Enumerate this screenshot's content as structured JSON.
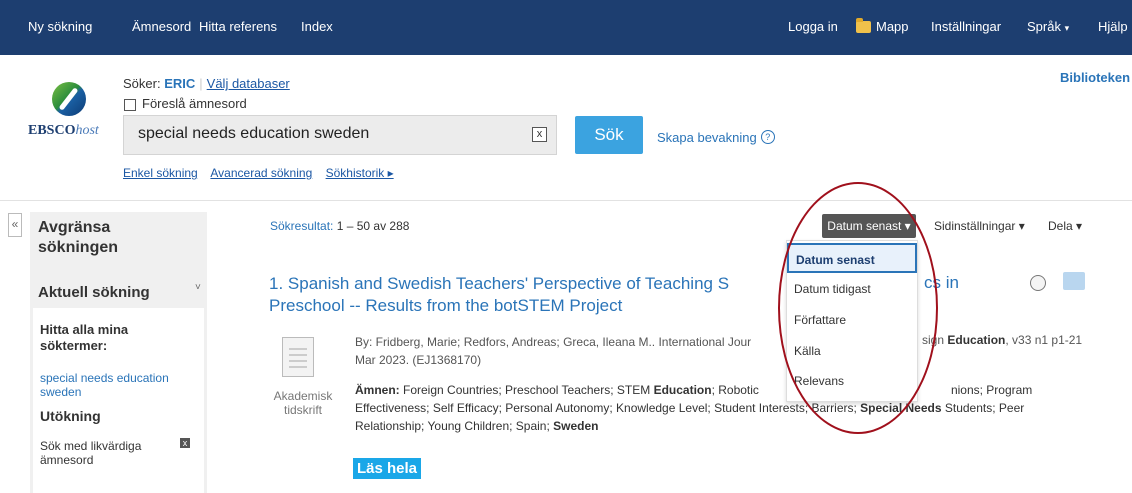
{
  "topnav": {
    "new_search": "Ny sökning",
    "subjects": "Ämnesord",
    "find_reference": "Hitta referens",
    "index": "Index",
    "login": "Logga in",
    "folder": "Mapp",
    "settings": "Inställningar",
    "language": "Språk",
    "language_caret": "▾",
    "help": "Hjälp"
  },
  "header": {
    "logo_text_main": "EBSCO",
    "logo_text_host": "host",
    "searching_label": "Söker:",
    "database": "ERIC",
    "choose_databases": "Välj databaser",
    "suggest_subjects": "Föreslå ämnesord",
    "search_value": "special needs education sweden",
    "clear_label": "x",
    "search_button": "Sök",
    "create_alert": "Skapa bevakning",
    "help_glyph": "?",
    "basic_search": "Enkel sökning",
    "advanced_search": "Avancerad sökning",
    "search_history": "Sökhistorik ▸",
    "library": "Biblioteken"
  },
  "sidebar": {
    "collapse_glyph": "«",
    "title": "Avgränsa sökningen",
    "current_search": "Aktuell sökning",
    "current_chevron": "˅",
    "find_all_terms": "Hitta alla mina söktermer:",
    "term": "special needs education sweden",
    "expand": "Utökning",
    "equivalent_subjects": "Sök med likvärdiga ämnesord",
    "equivalent_x": "x"
  },
  "results": {
    "count_label": "Sökresultat:",
    "count_value": "1 – 50 av 288"
  },
  "toolbar": {
    "sort_selected": "Datum senast ▾",
    "page_options": "Sidinställningar ▾",
    "share": "Dela ▾"
  },
  "sort_menu": {
    "options": [
      "Datum senast",
      "Datum tidigast",
      "Författare",
      "Källa",
      "Relevans"
    ],
    "selected_index": 0
  },
  "result1": {
    "index": "1.",
    "title_part1": "Spanish and Swedish Teachers' Perspective of Teaching S",
    "title_part2": "Preschool -- Results from the botSTEM Project",
    "title_right": "cs in",
    "doc_type": "Akademisk tidskrift",
    "by_line": "By: Fridberg, Marie; Redfors, Andreas; Greca, Ileana M.. International Jour",
    "by_line2": "Mar 2023. (EJ1368170)",
    "by_right_pre": "sign ",
    "by_right_bold": "Education",
    "by_right_post": ", v33 n1 p1-21",
    "subjects_label": "Ämnen:",
    "subjects_line1_a": " Foreign Countries; Preschool Teachers; STEM ",
    "subjects_line1_bold": "Education",
    "subjects_line1_b": "; Robotic",
    "subjects_line1_c": "nions; Program",
    "subjects_line2_a": "Effectiveness; Self Efficacy; Personal Autonomy; Knowledge Level; Student Interests; Barriers; ",
    "subjects_line2_bold": "Special Needs",
    "subjects_line2_b": " Students; Peer",
    "subjects_line3_a": "Relationship; Young Children; Spain; ",
    "subjects_line3_bold": "Sweden",
    "read_full": "Läs hela"
  },
  "colors": {
    "topbar": "#1d3e70",
    "link": "#2a74b8",
    "search_button": "#3ba3e0",
    "annotation_ellipse": "#a0101c",
    "read_full_bg": "#1aa7e8"
  }
}
